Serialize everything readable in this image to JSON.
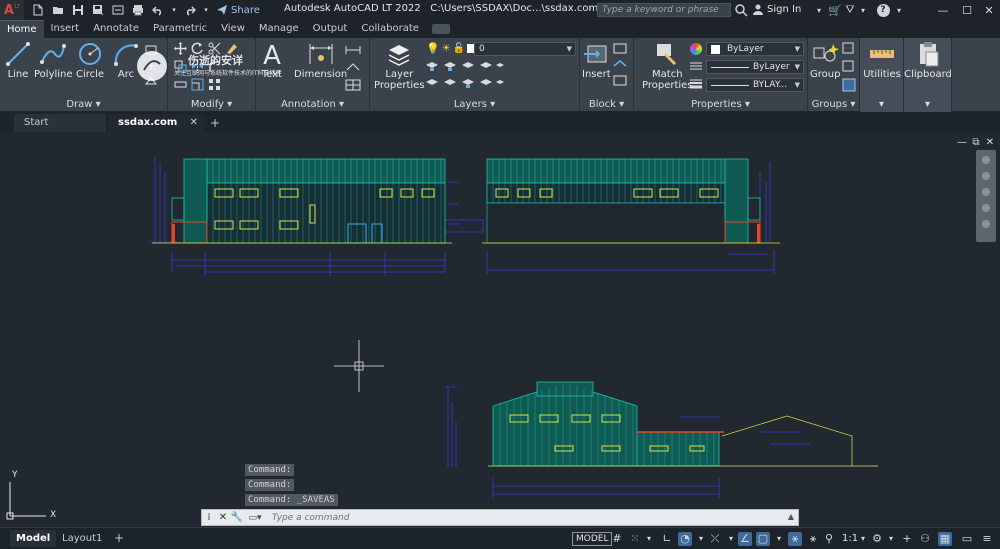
{
  "app": {
    "logo_letter": "A",
    "logo_badge": "LT",
    "title": "Autodesk AutoCAD LT 2022",
    "file_path": "C:\\Users\\SSDAX\\Doc...\\ssdax.com.dwg",
    "path_arrow": "›",
    "share_label": "Share",
    "search_placeholder": "Type a keyword or phrase",
    "sign_in_label": "Sign In",
    "help_label": "?"
  },
  "ribbon_tabs": [
    {
      "label": "Home",
      "active": true
    },
    {
      "label": "Insert"
    },
    {
      "label": "Annotate"
    },
    {
      "label": "Parametric"
    },
    {
      "label": "View"
    },
    {
      "label": "Manage"
    },
    {
      "label": "Output"
    },
    {
      "label": "Collaborate"
    }
  ],
  "ribbon": {
    "draw": {
      "title": "Draw",
      "line": "Line",
      "polyline": "Polyline",
      "circle": "Circle",
      "arc": "Arc"
    },
    "modify": {
      "title": "Modify"
    },
    "annotation": {
      "title": "Annotation",
      "text": "Text",
      "dimension": "Dimension"
    },
    "layers": {
      "title": "Layers",
      "layer_properties_1": "Layer",
      "layer_properties_2": "Properties",
      "current_layer": "0"
    },
    "block": {
      "title": "Block",
      "insert": "Insert"
    },
    "properties": {
      "title": "Properties",
      "match_1": "Match",
      "match_2": "Properties",
      "color": "ByLayer",
      "linetype": "ByLayer",
      "lineweight": "BYLAY..."
    },
    "groups": {
      "title": "Groups",
      "group": "Group"
    },
    "utilities": {
      "title": "Utilities"
    },
    "clipboard": {
      "title": "Clipboard"
    }
  },
  "watermark": {
    "title": "伤逝的安详",
    "subtitle": "关注互联网与系统软件技术的IT科技博客"
  },
  "doc_tabs": [
    {
      "label": "Start"
    },
    {
      "label": "ssdax.com",
      "active": true
    }
  ],
  "command": {
    "history": [
      "Command:",
      "Command:",
      "Command: _SAVEAS"
    ],
    "placeholder": "Type a command"
  },
  "ucs": {
    "x_label": "X",
    "y_label": "Y"
  },
  "status": {
    "layout_tabs": [
      {
        "label": "Model",
        "active": true
      },
      {
        "label": "Layout1"
      }
    ],
    "model_label": "MODEL",
    "scale_label": "1:1"
  },
  "colors": {
    "background": "#212830",
    "roof_fill": "#0f5a52",
    "wall_lines": "#1ec3b0",
    "dimension_lines": "#3a3ad8",
    "windows": "#d8e24a",
    "columns": "#e04a2a",
    "accent": "#3e6a9c"
  }
}
